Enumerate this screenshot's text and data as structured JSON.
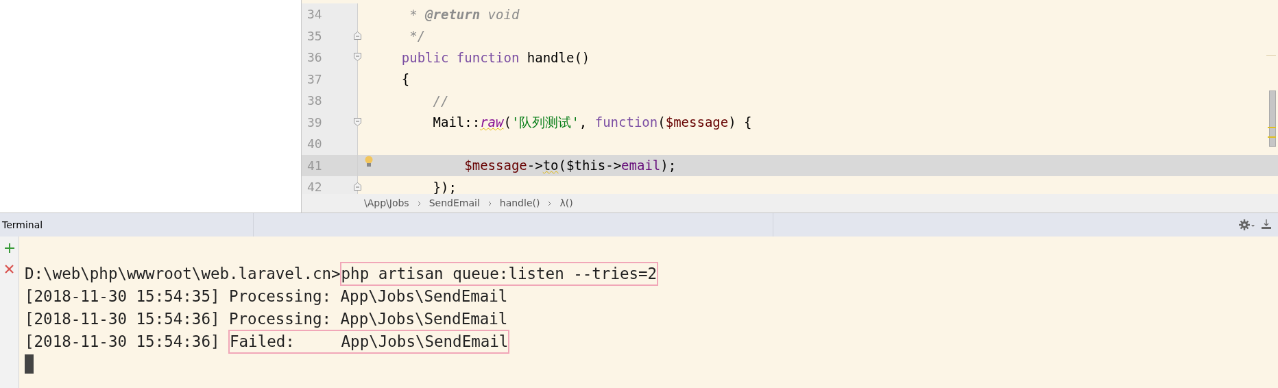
{
  "editor": {
    "lines": [
      {
        "number": "34",
        "highlighted": false,
        "fold_start": false,
        "fold_end": false,
        "bulb": false,
        "tokens": [
          {
            "text": "     * ",
            "kind": "comment",
            "warned": false
          },
          {
            "text": "@return",
            "kind": "doctag",
            "warned": false
          },
          {
            "text": " void",
            "kind": "comment",
            "warned": false
          }
        ]
      },
      {
        "number": "35",
        "highlighted": false,
        "fold_start": false,
        "fold_end": true,
        "bulb": false,
        "tokens": [
          {
            "text": "     */",
            "kind": "comment",
            "warned": false
          }
        ]
      },
      {
        "number": "36",
        "highlighted": false,
        "fold_start": true,
        "fold_end": false,
        "bulb": false,
        "tokens": [
          {
            "text": "    public ",
            "kind": "keyword",
            "warned": false
          },
          {
            "text": "function",
            "kind": "keyword",
            "warned": false
          },
          {
            "text": " handle()",
            "kind": "plain",
            "warned": false
          }
        ]
      },
      {
        "number": "37",
        "highlighted": false,
        "fold_start": false,
        "fold_end": false,
        "bulb": false,
        "tokens": [
          {
            "text": "    {",
            "kind": "plain",
            "warned": false
          }
        ]
      },
      {
        "number": "38",
        "highlighted": false,
        "fold_start": false,
        "fold_end": false,
        "bulb": false,
        "tokens": [
          {
            "text": "        //",
            "kind": "comment",
            "warned": false
          }
        ]
      },
      {
        "number": "39",
        "highlighted": false,
        "fold_start": true,
        "fold_end": false,
        "bulb": false,
        "tokens": [
          {
            "text": "        Mail::",
            "kind": "plain",
            "warned": false
          },
          {
            "text": "raw",
            "kind": "static",
            "warned": true
          },
          {
            "text": "(",
            "kind": "plain",
            "warned": false
          },
          {
            "text": "'队列测试'",
            "kind": "string",
            "warned": false
          },
          {
            "text": ", ",
            "kind": "plain",
            "warned": false
          },
          {
            "text": "function",
            "kind": "keyword",
            "warned": false
          },
          {
            "text": "(",
            "kind": "plain",
            "warned": false
          },
          {
            "text": "$message",
            "kind": "variable",
            "warned": false
          },
          {
            "text": ") {",
            "kind": "plain",
            "warned": false
          }
        ]
      },
      {
        "number": "40",
        "highlighted": false,
        "fold_start": false,
        "fold_end": false,
        "bulb": false
      },
      {
        "number": "41",
        "highlighted": true,
        "fold_start": false,
        "fold_end": false,
        "bulb": true,
        "tokens": [
          {
            "text": "            $message",
            "kind": "variable",
            "warned": false
          },
          {
            "text": "->",
            "kind": "plain",
            "warned": false
          },
          {
            "text": "to",
            "kind": "plain",
            "warned": true
          },
          {
            "text": "(",
            "kind": "plain",
            "warned": false
          },
          {
            "text": "$this",
            "kind": "plain",
            "warned": false
          },
          {
            "text": "->",
            "kind": "plain",
            "warned": false
          },
          {
            "text": "email",
            "kind": "property",
            "warned": false
          },
          {
            "text": ");",
            "kind": "plain",
            "warned": false
          }
        ]
      },
      {
        "number": "42",
        "highlighted": false,
        "fold_start": false,
        "fold_end": true,
        "bulb": false,
        "tokens": [
          {
            "text": "        });",
            "kind": "plain",
            "warned": false
          }
        ]
      }
    ],
    "breadcrumbs": [
      "\\App\\Jobs",
      "SendEmail",
      "handle()",
      "λ()"
    ]
  },
  "terminal": {
    "title": "Terminal",
    "lines": [
      {
        "segments": [
          {
            "text": "D:\\web\\php\\wwwroot\\web.laravel.cn>",
            "boxed": false
          },
          {
            "text": "php artisan queue:listen --tries=2",
            "boxed": true
          }
        ]
      },
      {
        "segments": [
          {
            "text": "[2018-11-30 15:54:35] Processing: App\\Jobs\\SendEmail",
            "boxed": false
          }
        ]
      },
      {
        "segments": [
          {
            "text": "[2018-11-30 15:54:36] Processing: App\\Jobs\\SendEmail",
            "boxed": false
          }
        ]
      },
      {
        "segments": [
          {
            "text": "[2018-11-30 15:54:36] ",
            "boxed": false
          },
          {
            "text": "Failed:     App\\Jobs\\SendEmail",
            "boxed": true
          }
        ]
      }
    ]
  }
}
